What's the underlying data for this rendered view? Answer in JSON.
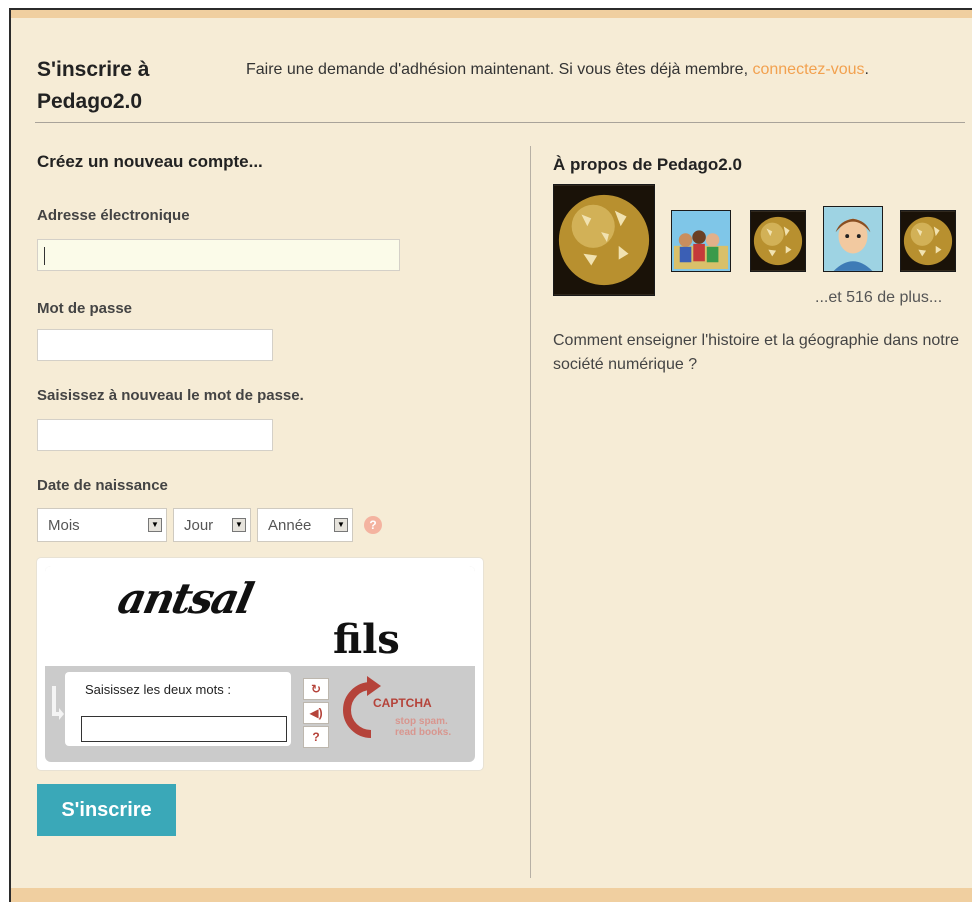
{
  "header": {
    "title_line1": "S'inscrire à",
    "title_line2": "Pedago2.0",
    "intro_text": "Faire une demande d'adhésion maintenant. Si vous êtes déjà membre, ",
    "login_link": "connectez-vous",
    "intro_end": "."
  },
  "form": {
    "section_title": "Créez un nouveau compte...",
    "email_label": "Adresse électronique",
    "email_value": "",
    "password_label": "Mot de passe",
    "password_value": "",
    "password_confirm_label": "Saisissez à nouveau le mot de passe.",
    "password_confirm_value": "",
    "birthdate_label": "Date de naissance",
    "month_select": "Mois",
    "day_select": "Jour",
    "year_select": "Année",
    "help_icon": "?",
    "submit_label": "S'inscrire"
  },
  "captcha": {
    "word1": "antsal",
    "word2": "fils",
    "entry_label": "Saisissez les deux mots :",
    "entry_value": "",
    "logo_text": "CAPTCHA",
    "tagline1": "stop spam.",
    "tagline2": "read books."
  },
  "sidebar": {
    "title": "À propos de Pedago2.0",
    "more_members": "...et 516 de plus...",
    "description": "Comment enseigner l'histoire et la géographie dans notre société numérique ?"
  },
  "colors": {
    "background": "#f6ecd6",
    "accent_link": "#f2a14f",
    "button": "#3aa8b8",
    "top_bar": "#f0cfa0"
  }
}
